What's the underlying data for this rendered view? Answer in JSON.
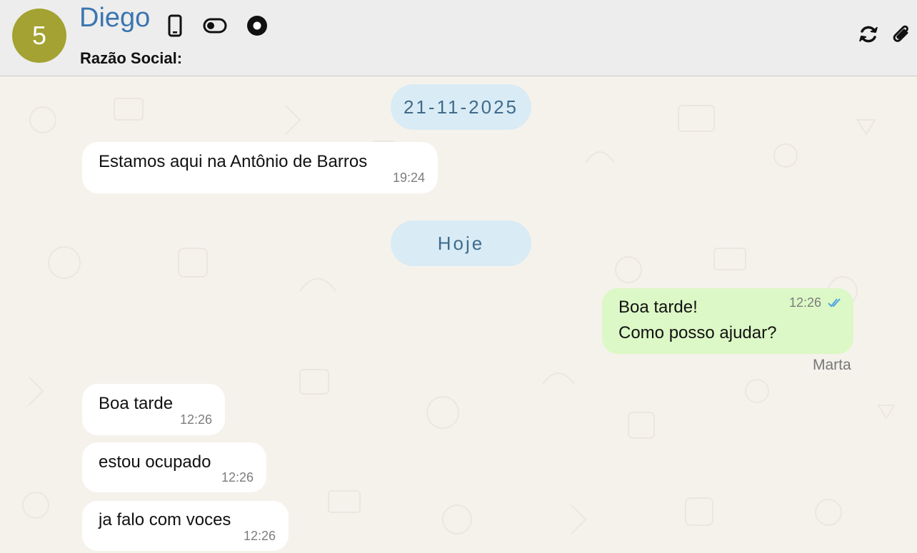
{
  "header": {
    "avatar_text": "5",
    "contact_name": "Diego",
    "razao_label": "Razão Social:",
    "razao_value": "",
    "icons": [
      "phone-icon",
      "toggle-icon",
      "record-icon"
    ],
    "right_icons": [
      "refresh-icon",
      "paperclip-icon"
    ]
  },
  "chat": {
    "dates": {
      "first": "21-11-2025",
      "second": "Hoje"
    },
    "messages": [
      {
        "direction": "in",
        "text": "Estamos aqui na Antônio de Barros",
        "time": "19:24"
      },
      {
        "direction": "out",
        "lines": [
          "Boa tarde!",
          "Como posso ajudar?"
        ],
        "time": "12:26",
        "status": "read",
        "sender": "Marta"
      },
      {
        "direction": "in",
        "text": "Boa tarde",
        "time": "12:26"
      },
      {
        "direction": "in",
        "text": "estou ocupado",
        "time": "12:26"
      },
      {
        "direction": "in",
        "text": "ja falo com voces",
        "time": "12:26"
      }
    ]
  },
  "colors": {
    "avatar_bg": "#a3a232",
    "name_color": "#3a76b0",
    "date_pill_bg": "#d9ebf5",
    "out_bubble_bg": "#dcf8c6",
    "check_color": "#4fa3e0",
    "chat_bg": "#f5f2ec"
  }
}
